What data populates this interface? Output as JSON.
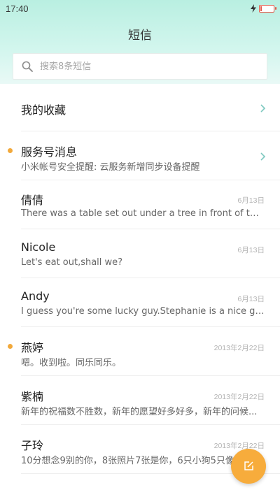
{
  "status": {
    "time": "17:40",
    "battery_level": 0.1
  },
  "header": {
    "title": "短信"
  },
  "search": {
    "placeholder": "搜索8条短信"
  },
  "favorites": {
    "label": "我的收藏"
  },
  "service": {
    "label": "服务号消息",
    "preview": "小米帐号安全提醒: 云服务新增同步设备提醒",
    "unread": true
  },
  "messages": [
    {
      "name": "倩倩",
      "preview": "There was a table set out under a tree in front of the ho...",
      "date": "6月13日",
      "unread": false
    },
    {
      "name": "Nicole",
      "preview": "Let's eat out,shall we?",
      "date": "6月13日",
      "unread": false
    },
    {
      "name": "Andy",
      "preview": "I guess you're some lucky guy.Stephanie is a nice girl.",
      "date": "6月13日",
      "unread": false
    },
    {
      "name": "燕婷",
      "preview": "嗯。收到啦。同乐同乐。",
      "date": "2013年2月22日",
      "unread": true
    },
    {
      "name": "紫楠",
      "preview": "新年的祝福数不胜数，新年的愿望好多好多，新年的问候...",
      "date": "2013年2月22日",
      "unread": false
    },
    {
      "name": "子玲",
      "preview": "10分想念9别的你，8张照片7张是你，6只小狗5只像你",
      "date": "2013年2月22日",
      "unread": false
    }
  ],
  "colors": {
    "accent": "#f7ac3c",
    "header": "#c6f2e7",
    "chevron": "#7fc9c0"
  }
}
